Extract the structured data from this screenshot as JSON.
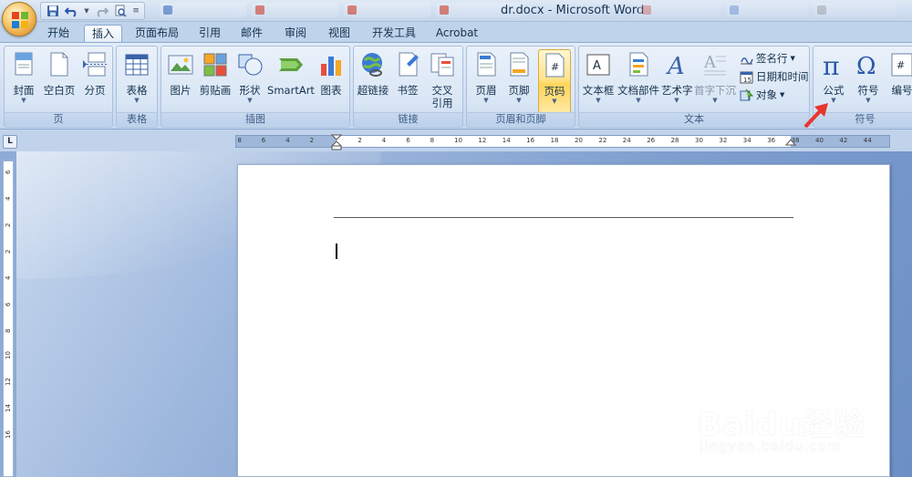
{
  "window": {
    "title": "dr.docx - Microsoft Word"
  },
  "tabs": [
    {
      "label": "开始",
      "active": false
    },
    {
      "label": "插入",
      "active": true
    },
    {
      "label": "页面布局",
      "active": false
    },
    {
      "label": "引用",
      "active": false
    },
    {
      "label": "邮件",
      "active": false
    },
    {
      "label": "审阅",
      "active": false
    },
    {
      "label": "视图",
      "active": false
    },
    {
      "label": "开发工具",
      "active": false
    },
    {
      "label": "Acrobat",
      "active": false
    }
  ],
  "groups": {
    "pages": {
      "label": "页",
      "buttons": [
        "封面",
        "空白页",
        "分页"
      ]
    },
    "tables": {
      "label": "表格",
      "buttons": [
        "表格"
      ]
    },
    "illustrations": {
      "label": "插图",
      "buttons": [
        "图片",
        "剪贴画",
        "形状",
        "SmartArt",
        "图表"
      ]
    },
    "links": {
      "label": "链接",
      "buttons": [
        "超链接",
        "书签",
        "交叉",
        "引用"
      ]
    },
    "header_footer": {
      "label": "页眉和页脚",
      "buttons": [
        "页眉",
        "页脚",
        "页码"
      ]
    },
    "text": {
      "label": "文本",
      "buttons": [
        "文本框",
        "文档部件",
        "艺术字",
        "首字下沉"
      ],
      "small": [
        "签名行",
        "日期和时间",
        "对象"
      ]
    },
    "symbols": {
      "label": "符号",
      "buttons": [
        "公式",
        "符号",
        "编号"
      ]
    }
  },
  "ruler": {
    "left_ticks": [
      "8",
      "6",
      "4",
      "2"
    ],
    "right_ticks": [
      "2",
      "4",
      "6",
      "8",
      "10",
      "12",
      "14",
      "16",
      "18",
      "20",
      "22",
      "24",
      "26",
      "28",
      "30",
      "32",
      "34",
      "36",
      "38",
      "40",
      "42",
      "44"
    ],
    "vertical_ticks": [
      "6",
      "4",
      "2",
      "2",
      "4",
      "6",
      "8",
      "10",
      "12",
      "14",
      "16"
    ],
    "corner": "L"
  },
  "watermark": {
    "main": "Baidu经验",
    "sub": "jingyan.baidu.com"
  },
  "colors": {
    "accent": "#ffd55a",
    "ribbon": "#d0def0",
    "workspace": "#7f9fcf",
    "arrow": "#e8352d"
  }
}
